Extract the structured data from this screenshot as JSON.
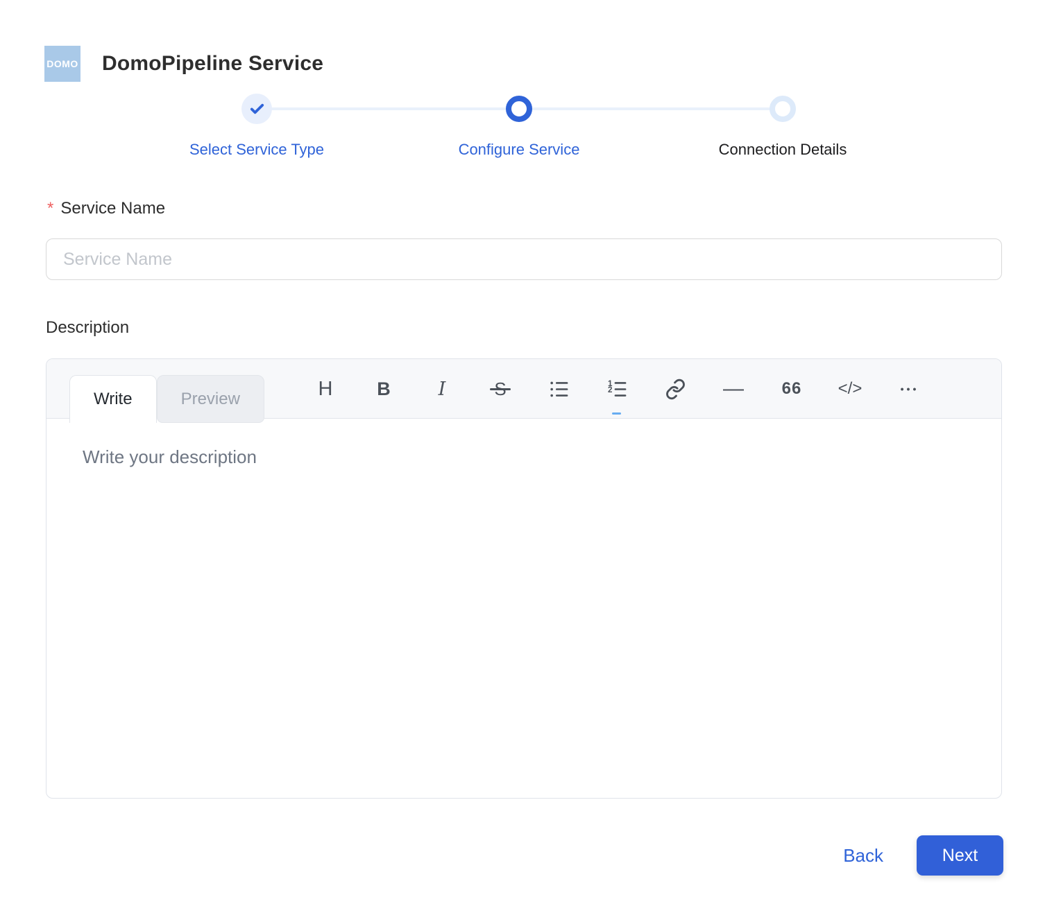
{
  "header": {
    "logo_text": "DOMO",
    "title": "DomoPipeline Service"
  },
  "stepper": {
    "steps": [
      {
        "label": "Select Service Type",
        "state": "complete"
      },
      {
        "label": "Configure Service",
        "state": "active"
      },
      {
        "label": "Connection Details",
        "state": "upcoming"
      }
    ]
  },
  "form": {
    "service_name": {
      "required_marker": "*",
      "label": "Service Name",
      "placeholder": "Service Name",
      "value": ""
    },
    "description": {
      "label": "Description",
      "editor": {
        "tabs": [
          {
            "label": "Write",
            "active": true
          },
          {
            "label": "Preview",
            "active": false
          }
        ],
        "toolbar": [
          {
            "name": "heading",
            "glyph": "H"
          },
          {
            "name": "bold",
            "glyph": "B"
          },
          {
            "name": "italic",
            "glyph": "I"
          },
          {
            "name": "strikethrough",
            "glyph": "S"
          },
          {
            "name": "unordered-list"
          },
          {
            "name": "ordered-list"
          },
          {
            "name": "link"
          },
          {
            "name": "horizontal-rule",
            "glyph": "—"
          },
          {
            "name": "quote",
            "glyph": "66"
          },
          {
            "name": "code",
            "glyph": "</>"
          },
          {
            "name": "more",
            "glyph": "•••"
          }
        ],
        "placeholder": "Write your description",
        "value": ""
      }
    }
  },
  "footer": {
    "back_label": "Back",
    "next_label": "Next"
  },
  "colors": {
    "accent_blue": "#2f63d8",
    "track_light_blue": "#e9f1fb",
    "complete_circle_bg": "#e8effc",
    "upcoming_ring": "#ddeafa",
    "logo_bg": "#a9c9e8",
    "next_button_bg": "#3160d8",
    "required_red": "#ee6060",
    "editor_header_bg": "#f7f8fa"
  }
}
